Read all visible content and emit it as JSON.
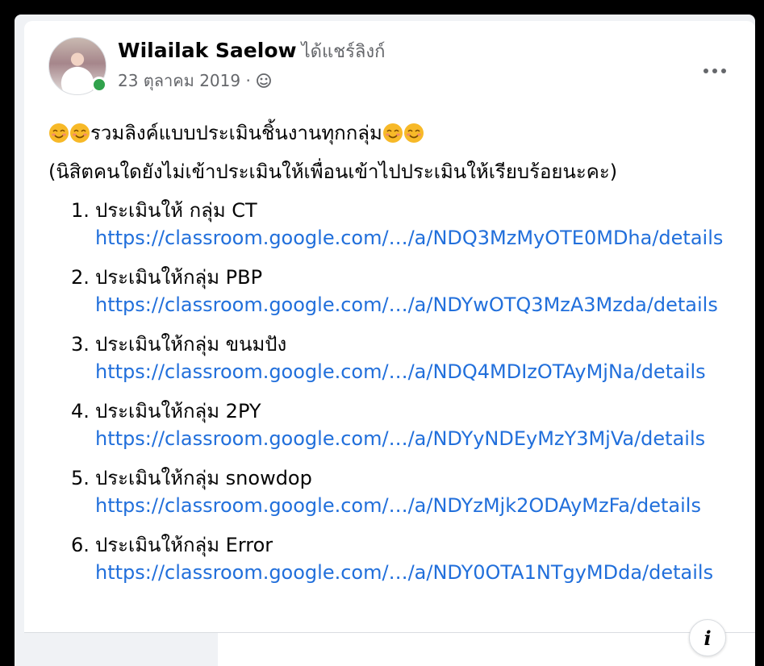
{
  "post": {
    "author": "Wilailak Saelow",
    "action": "ได้แชร์ลิงก์",
    "date": "23 ตุลาคม 2019 ·",
    "privacy_icon": "globe-icon",
    "more_icon": "more-options-icon",
    "headline": "รวมลิงค์แบบประเมินชิ้นงานทุกกลุ่ม",
    "headline_emoji": "smiling-face-emoji",
    "note": "(นิสิตคนใดยังไม่เข้าประเมินให้เพื่อนเข้าไปประเมินให้เรียบร้อยนะคะ)",
    "items": [
      {
        "num": "1.",
        "text": "ประเมินให้ กลุ่ม CT",
        "link": "https://classroom.google.com/…/a/NDQ3MzMyOTE0MDha/details"
      },
      {
        "num": "2.",
        "text": "ประเมินให้กลุ่ม PBP",
        "link": "https://classroom.google.com/…/a/NDYwOTQ3MzA3Mzda/details"
      },
      {
        "num": "3.",
        "text": "ประเมินให้กลุ่ม ขนมปัง",
        "link": "https://classroom.google.com/…/a/NDQ4MDIzOTAyMjNa/details"
      },
      {
        "num": "4.",
        "text": "ประเมินให้กลุ่ม 2PY",
        "link": "https://classroom.google.com/…/a/NDYyNDEyMzY3MjVa/details"
      },
      {
        "num": "5.",
        "text": "ประเมินให้กลุ่ม snowdop",
        "link": "https://classroom.google.com/…/a/NDYzMjk2ODAyMzFa/details"
      },
      {
        "num": "6.",
        "text": "ประเมินให้กลุ่ม Error",
        "link": "https://classroom.google.com/…/a/NDY0OTA1NTgyMDda/details"
      }
    ]
  },
  "info_button": {
    "icon": "info-icon",
    "label": "i"
  },
  "colors": {
    "link": "#216fdb",
    "text": "#050505",
    "secondary": "#65676b",
    "online": "#31a24c",
    "page_bg": "#000000"
  }
}
